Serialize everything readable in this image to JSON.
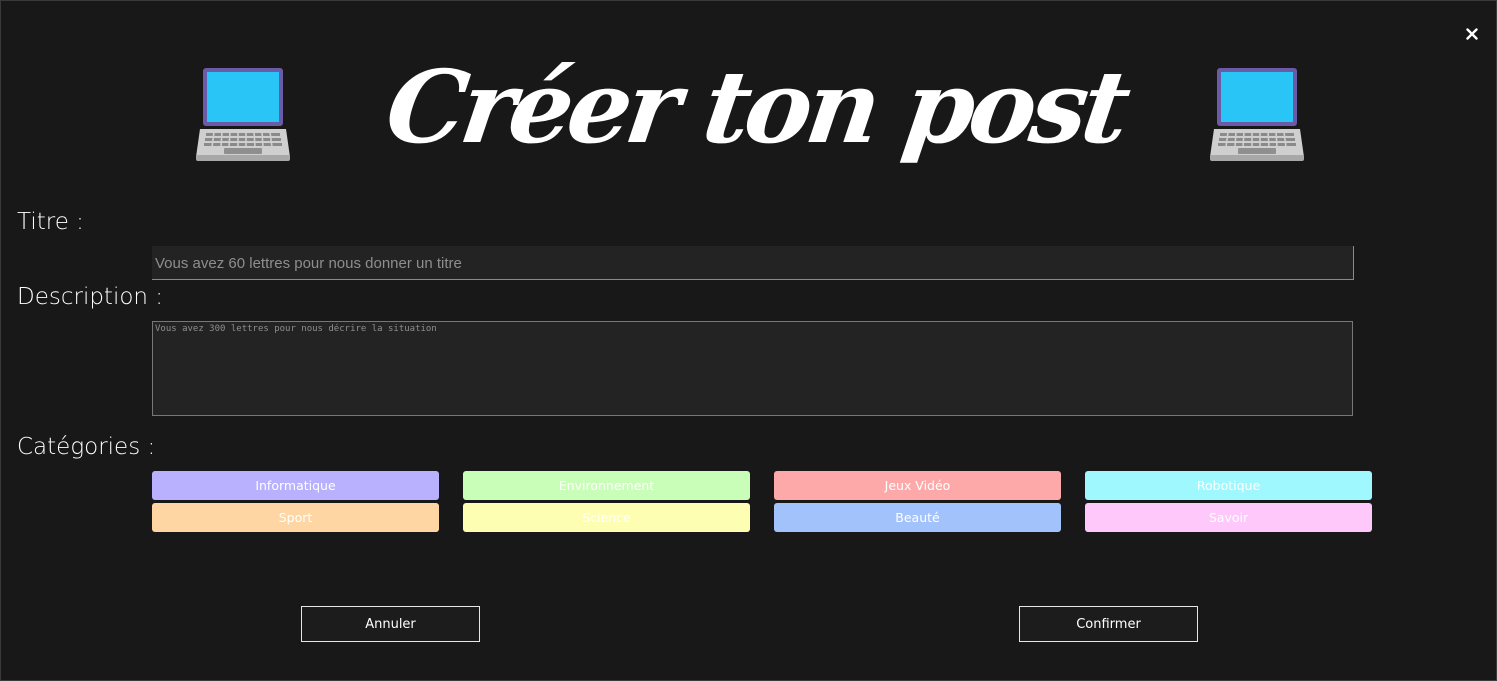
{
  "modal": {
    "title": "Créer ton post",
    "close_icon": "close-icon",
    "decor_icon": "laptop-icon"
  },
  "form": {
    "titre_label": "Titre :",
    "titre_placeholder": "Vous avez 60 lettres pour nous donner un titre",
    "titre_value": "",
    "description_label": "Description :",
    "description_placeholder": "Vous avez 300 lettres pour nous décrire la situation",
    "description_value": "",
    "categories_label": "Catégories :"
  },
  "categories": [
    {
      "label": "Informatique",
      "color": "#b9b0fe"
    },
    {
      "label": "Environnement",
      "color": "#c9feb9"
    },
    {
      "label": "Jeux Vidéo",
      "color": "#fea9a9"
    },
    {
      "label": "Robotique",
      "color": "#9ef8fe"
    },
    {
      "label": "Sport",
      "color": "#fed6a4"
    },
    {
      "label": "Science",
      "color": "#fdfeb1"
    },
    {
      "label": "Beauté",
      "color": "#a2c2fc"
    },
    {
      "label": "Savoir",
      "color": "#fec8fb"
    }
  ],
  "actions": {
    "cancel_label": "Annuler",
    "confirm_label": "Confirmer"
  },
  "colors": {
    "background": "#181818",
    "input_background": "#232323",
    "text": "#ffffff"
  }
}
